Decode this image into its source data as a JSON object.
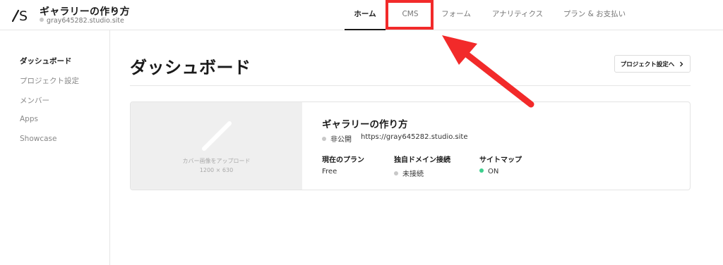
{
  "header": {
    "site_title": "ギャラリーの作り方",
    "site_url": "gray645282.studio.site",
    "tabs": [
      {
        "label": "ホーム",
        "active": true
      },
      {
        "label": "CMS",
        "active": false
      },
      {
        "label": "フォーム",
        "active": false
      },
      {
        "label": "アナリティクス",
        "active": false
      },
      {
        "label": "プラン & お支払い",
        "active": false
      }
    ]
  },
  "sidebar": {
    "items": [
      {
        "label": "ダッシュボード",
        "active": true
      },
      {
        "label": "プロジェクト設定",
        "active": false
      },
      {
        "label": "メンバー",
        "active": false
      },
      {
        "label": "Apps",
        "active": false
      },
      {
        "label": "Showcase",
        "active": false
      }
    ]
  },
  "main": {
    "page_title": "ダッシュボード",
    "settings_button": "プロジェクト設定へ",
    "card": {
      "cover_label": "カバー画像をアップロード",
      "cover_size": "1200 × 630",
      "title": "ギャラリーの作り方",
      "visibility": "非公開",
      "url": "https://gray645282.studio.site",
      "plan_label": "現在のプラン",
      "plan_value": "Free",
      "domain_label": "独自ドメイン接続",
      "domain_value": "未接続",
      "sitemap_label": "サイトマップ",
      "sitemap_value": "ON"
    }
  },
  "colors": {
    "annotation_red": "#f22a2a",
    "status_off": "#c8c8c8",
    "status_on": "#3ecf8e"
  },
  "icons": {
    "logo": "studio-logo",
    "site_menu": "chevron-down-icon",
    "settings_arrow": "chevron-right-icon",
    "cover": "image-placeholder-icon"
  }
}
